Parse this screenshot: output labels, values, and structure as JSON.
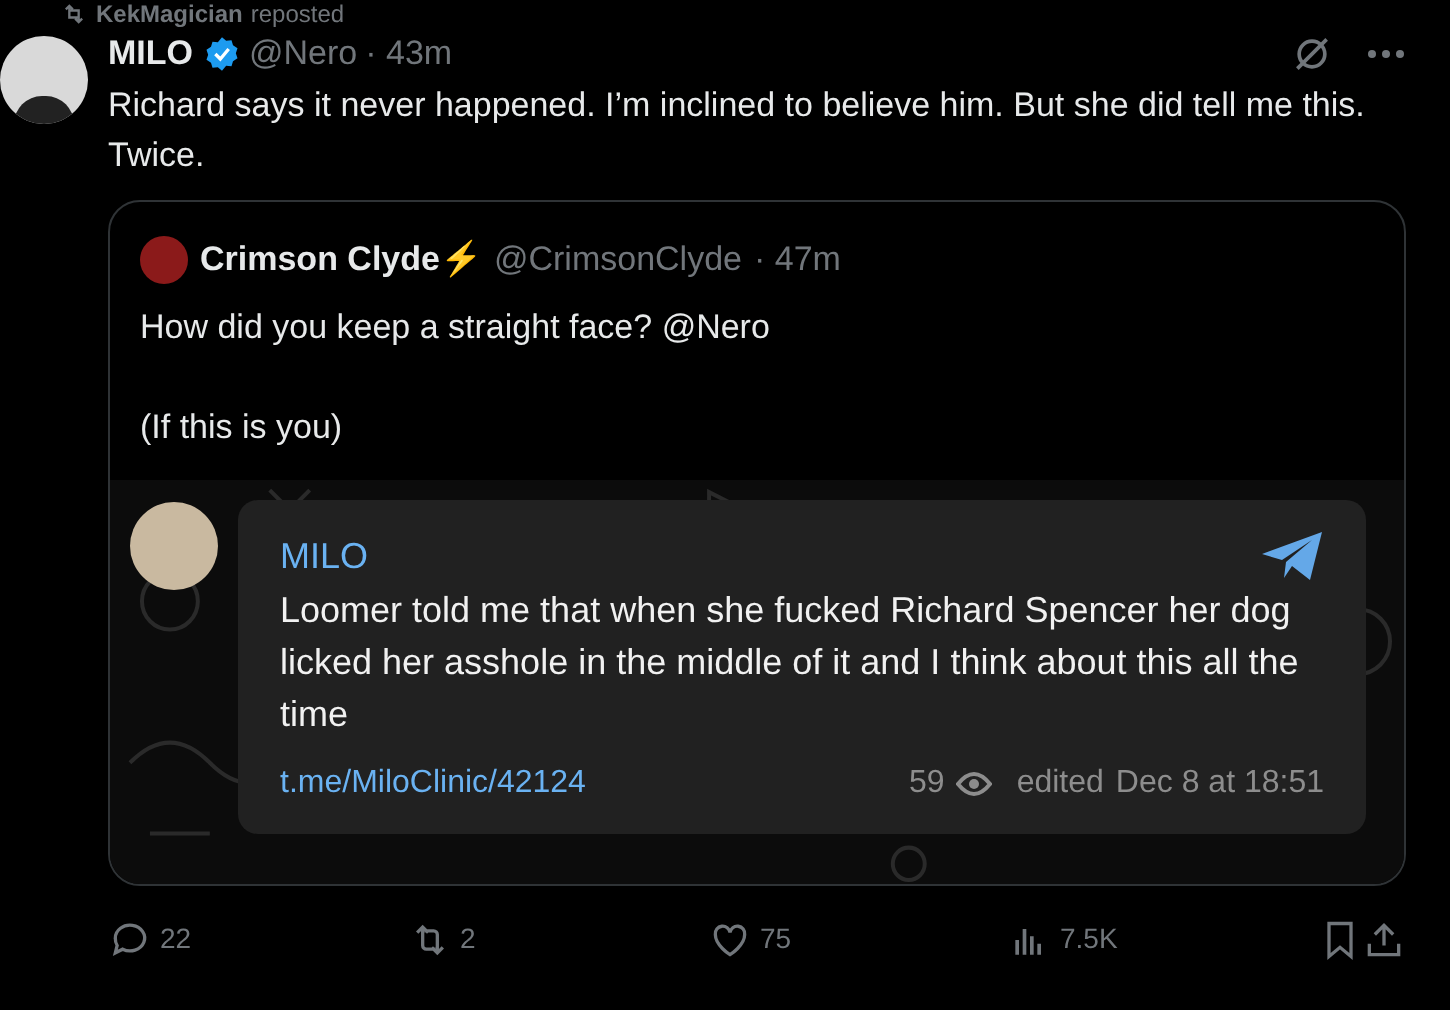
{
  "repost": {
    "user": "KekMagician",
    "label": "reposted"
  },
  "post": {
    "name": "MILO",
    "verified": true,
    "handle": "@Nero",
    "time": "· 43m",
    "text": "Richard says it never happened. I’m inclined to believe him. But she did tell me this. Twice."
  },
  "quote": {
    "name": "Crimson Clyde⚡",
    "handle": "@CrimsonClyde",
    "time": "· 47m",
    "lines": [
      "How did you keep a straight face? @Nero",
      "(If this is you)"
    ]
  },
  "telegram": {
    "name": "MILO",
    "text": "Loomer told me that when she fucked Richard Spencer her dog licked her asshole in the middle of it and I think about this all the time",
    "link": "t.me/MiloClinic/42124",
    "views": "59",
    "edited": "edited",
    "date": "Dec 8 at 18:51"
  },
  "actions": [
    {
      "kind": "reply",
      "count": "22"
    },
    {
      "kind": "repost",
      "count": "2"
    },
    {
      "kind": "like",
      "count": "75"
    },
    {
      "kind": "views",
      "count": "7.5K"
    },
    {
      "kind": "bookmark"
    },
    {
      "kind": "share"
    }
  ]
}
